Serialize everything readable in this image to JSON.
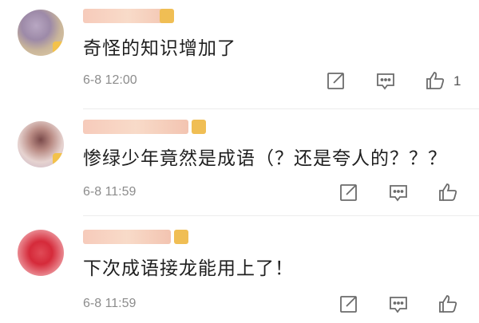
{
  "comments": [
    {
      "text": "奇怪的知识增加了",
      "time": "6-8 12:00",
      "likes": "1",
      "icons": [
        "edit-icon",
        "comment-icon",
        "like-icon"
      ]
    },
    {
      "text": "惨绿少年竟然是成语（？还是夸人的？？？",
      "time": "6-8 11:59",
      "likes": "",
      "icons": [
        "edit-icon",
        "comment-icon",
        "like-icon"
      ]
    },
    {
      "text": "下次成语接龙能用上了！",
      "time": "6-8 11:59",
      "likes": "",
      "icons": [
        "edit-icon",
        "comment-icon",
        "like-icon"
      ]
    }
  ],
  "colors": {
    "badge": "#f3c24b",
    "text": "#1f1f1f",
    "meta": "#8c8c8c"
  }
}
